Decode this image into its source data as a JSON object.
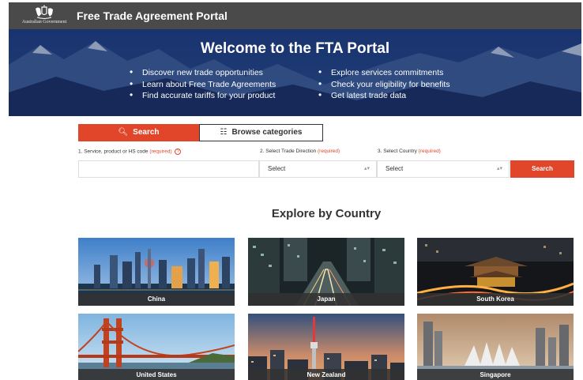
{
  "header": {
    "gov_label": "Australian Government",
    "title": "Free Trade Agreement Portal"
  },
  "hero": {
    "title": "Welcome to the FTA Portal",
    "bullets_left": [
      "Discover new trade opportunities",
      "Learn about Free Trade Agreements",
      "Find accurate tariffs for your product"
    ],
    "bullets_right": [
      "Explore services commitments",
      "Check your eligibility for benefits",
      "Get latest trade data"
    ]
  },
  "search": {
    "tab_search_label": "Search",
    "tab_browse_label": "Browse categories",
    "field1_label": "1. Service, product or HS code",
    "field2_label": "2. Select Trade Direction",
    "field3_label": "3. Select Country",
    "required_label": "(required)",
    "help_icon": "?",
    "direction_value": "Select",
    "country_value": "Select",
    "submit_label": "Search"
  },
  "explore": {
    "title": "Explore by Country",
    "countries": [
      "China",
      "Japan",
      "South Korea",
      "United States",
      "New Zealand",
      "Singapore"
    ]
  }
}
